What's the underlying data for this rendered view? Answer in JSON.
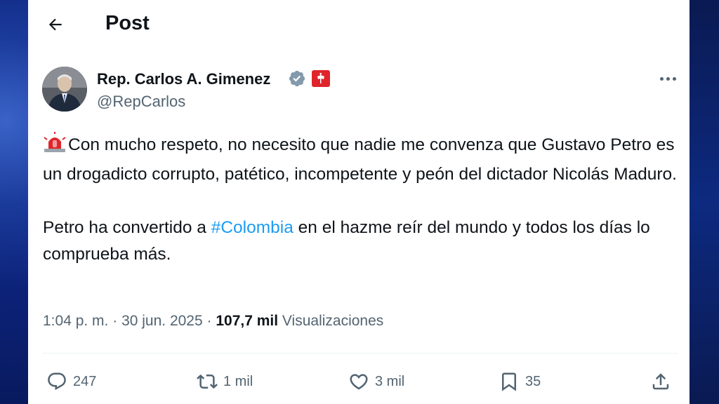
{
  "header": {
    "title": "Post"
  },
  "author": {
    "name": "Rep. Carlos A. Gimenez",
    "handle": "@RepCarlos"
  },
  "tweet": {
    "paragraph1": "Con mucho respeto, no necesito que nadie me convenza que Gustavo Petro es un drogadicto corrupto, patético, incompetente y peón del dictador Nicolás Maduro.",
    "paragraph2_before": "Petro ha convertido a ",
    "hashtag": "#Colombia",
    "paragraph2_after": " en el hazme reír del mundo y todos los días lo comprueba más."
  },
  "meta": {
    "time": "1:04 p. m.",
    "separator1": " · ",
    "date": "30 jun. 2025",
    "separator2": " · ",
    "views_count": "107,7 mil",
    "views_label": " Visualizaciones"
  },
  "actions": {
    "replies": "247",
    "reposts": "1 mil",
    "likes": "3 mil",
    "bookmarks": "35"
  },
  "icons": {
    "back": "arrow-left-icon",
    "verified": "verified-badge-icon",
    "flag": "red-flag-badge-icon",
    "more": "more-options-icon",
    "siren": "siren-emoji-icon",
    "reply": "reply-icon",
    "repost": "repost-icon",
    "like": "heart-icon",
    "bookmark": "bookmark-icon",
    "share": "share-icon"
  },
  "colors": {
    "text": "#0f1419",
    "secondary": "#536471",
    "link": "#1d9bf0",
    "verified": "#829aab",
    "siren": "#e0242b"
  }
}
